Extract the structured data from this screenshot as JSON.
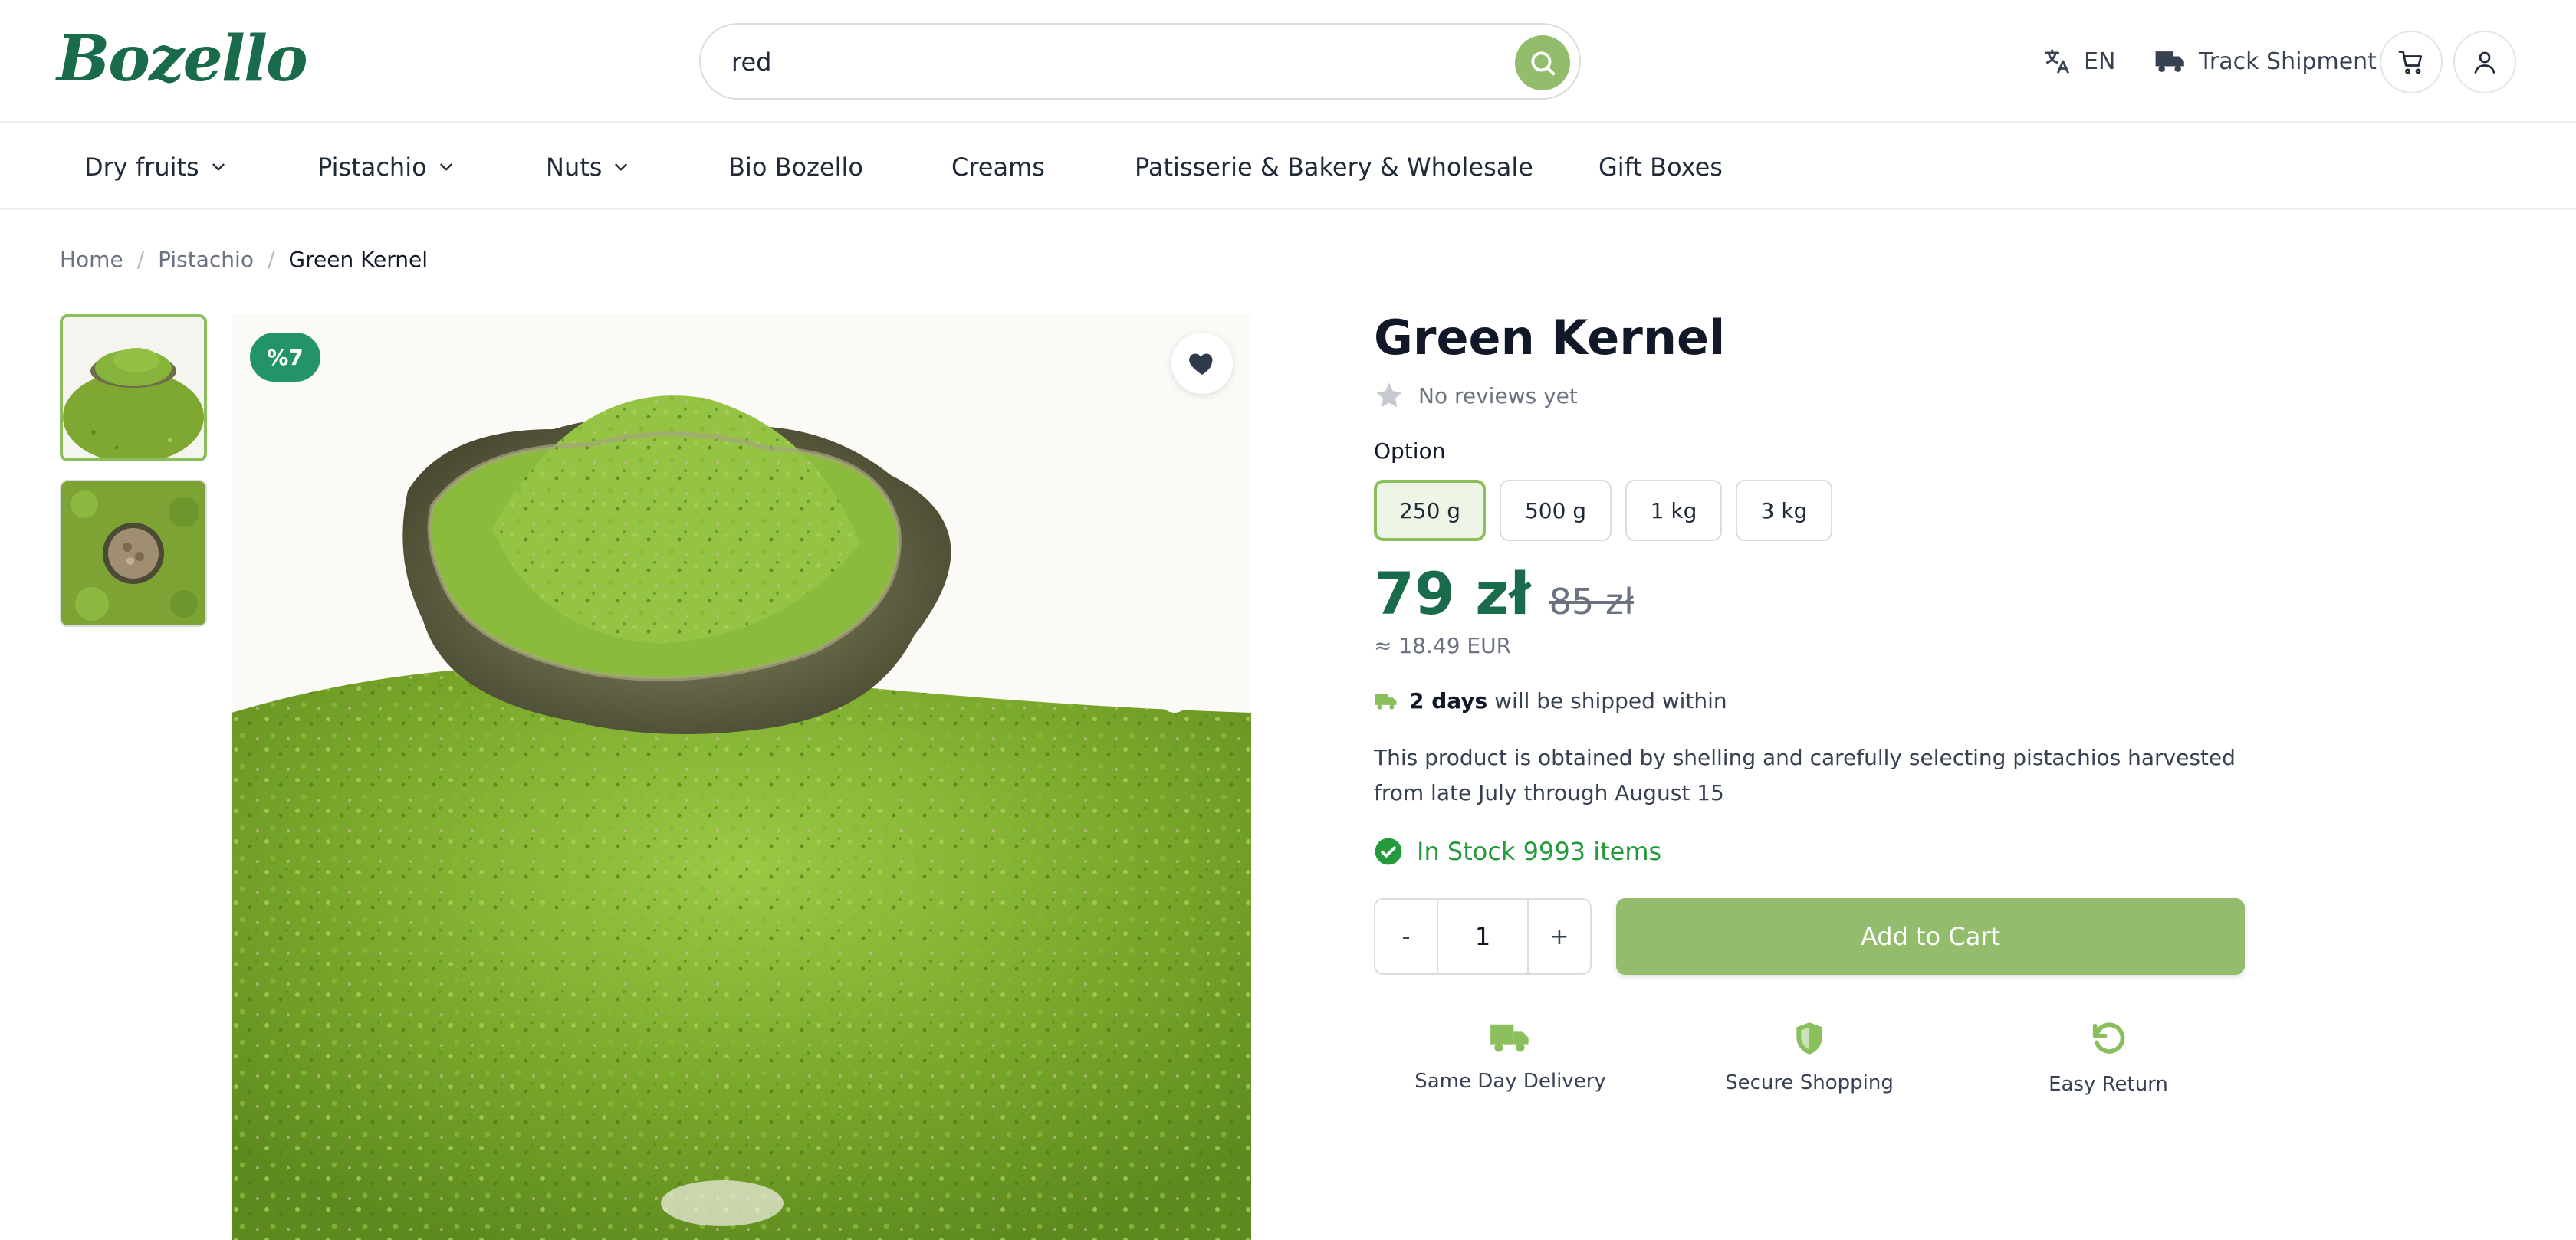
{
  "header": {
    "logo": "Bozello",
    "search": {
      "value": "red"
    },
    "language": "EN",
    "track_shipment": "Track Shipment"
  },
  "nav": {
    "items": [
      {
        "label": "Dry fruits",
        "dropdown": true
      },
      {
        "label": "Pistachio",
        "dropdown": true
      },
      {
        "label": "Nuts",
        "dropdown": true
      },
      {
        "label": "Bio Bozello",
        "dropdown": false
      },
      {
        "label": "Creams",
        "dropdown": false
      },
      {
        "label": "Patisserie & Bakery & Wholesale",
        "dropdown": false
      },
      {
        "label": "Gift Boxes",
        "dropdown": false
      }
    ]
  },
  "breadcrumb": {
    "home": "Home",
    "separator": "/",
    "category": "Pistachio",
    "current": "Green Kernel"
  },
  "gallery": {
    "discount_badge": "%7",
    "selected_thumbnail": 1
  },
  "product": {
    "title": "Green Kernel",
    "reviews": "No reviews yet",
    "option_label": "Option",
    "options": [
      "250 g",
      "500 g",
      "1 kg",
      "3 kg"
    ],
    "selected_option": "250 g",
    "price": "79 zł",
    "old_price": "85 zł",
    "eur_price": "≈ 18.49 EUR",
    "shipping_days": "2 days",
    "shipping_text": "will be shipped within",
    "description": "This product is obtained by shelling and carefully selecting pistachios harvested from late July through August 15",
    "stock": "In Stock 9993 items",
    "quantity": {
      "minus": "-",
      "value": "1",
      "plus": "+"
    },
    "add_to_cart": "Add to Cart"
  },
  "features": [
    {
      "label": "Same Day Delivery",
      "icon": "truck-icon"
    },
    {
      "label": "Secure Shopping",
      "icon": "shield-icon"
    },
    {
      "label": "Easy Return",
      "icon": "return-icon"
    }
  ],
  "colors": {
    "brand": "#1a6b4c",
    "accent": "#93bd6c",
    "badge": "#23946a",
    "stock": "#249a3c"
  }
}
